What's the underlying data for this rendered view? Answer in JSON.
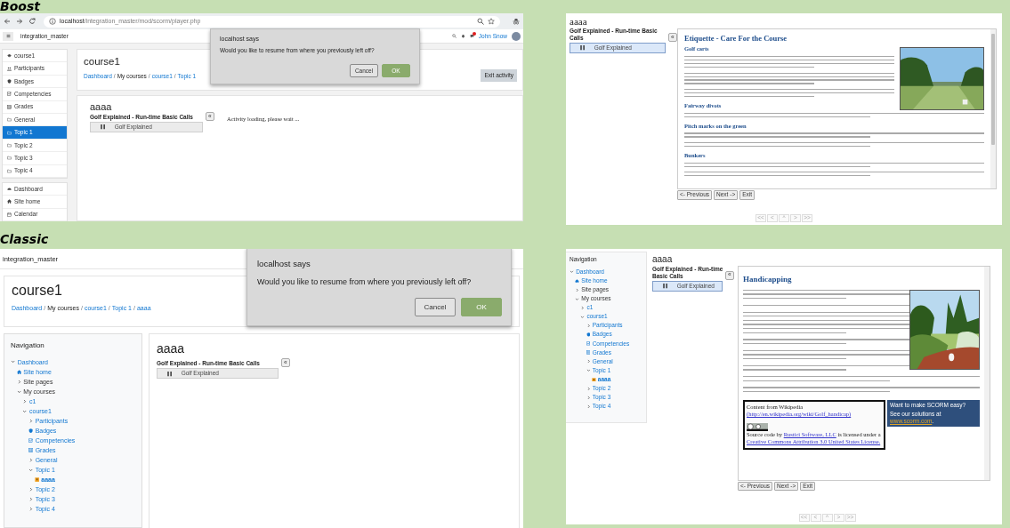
{
  "boost": {
    "caption": "Boost",
    "browser": {
      "host": "localhost",
      "path": "/integration_master/mod/scorm/player.php"
    },
    "navbar": {
      "site_name": "integration_master",
      "user_name": "John Snow",
      "message_alert": true
    },
    "sidebar": {
      "course_items": [
        {
          "label": "course1",
          "kind": "course",
          "selected": false
        },
        {
          "label": "Participants",
          "kind": "participants",
          "selected": false
        },
        {
          "label": "Badges",
          "kind": "badges",
          "selected": false
        },
        {
          "label": "Competencies",
          "kind": "competencies",
          "selected": false
        },
        {
          "label": "Grades",
          "kind": "grades",
          "selected": false
        },
        {
          "label": "General",
          "kind": "section",
          "selected": false
        },
        {
          "label": "Topic 1",
          "kind": "section",
          "selected": true
        },
        {
          "label": "Topic 2",
          "kind": "section",
          "selected": false
        },
        {
          "label": "Topic 3",
          "kind": "section",
          "selected": false
        },
        {
          "label": "Topic 4",
          "kind": "section",
          "selected": false
        }
      ],
      "site_items": [
        {
          "label": "Dashboard",
          "kind": "dashboard",
          "selected": false
        },
        {
          "label": "Site home",
          "kind": "home",
          "selected": false
        },
        {
          "label": "Calendar",
          "kind": "calendar",
          "selected": false
        }
      ]
    },
    "page_header": {
      "title": "course1",
      "breadcrumbs": [
        {
          "text": "Dashboard",
          "link": true,
          "separator": "/"
        },
        {
          "text": "My courses",
          "link": false,
          "separator": "/"
        },
        {
          "text": "course1",
          "link": true,
          "separator": "/"
        },
        {
          "text": "Topic 1",
          "link": true
        }
      ],
      "action": "Exit activity"
    },
    "activity": {
      "title": "aaaa",
      "toc_title": "Golf Explained - Run-time Basic Calls",
      "toc_toggle": "«",
      "toc_items": [
        {
          "label": "Golf Explained",
          "selected": false
        }
      ],
      "loading_text": "Activity loading, please wait ..."
    },
    "dialog": {
      "title": "localhost says",
      "message": "Would you like to resume from where you previously left off?",
      "buttons": [
        {
          "label": "Cancel",
          "primary": false
        },
        {
          "label": "OK",
          "primary": true
        }
      ]
    }
  },
  "boost_player": {
    "activity": {
      "title": "aaaa",
      "toc_title": "Golf Explained - Run-time Basic Calls",
      "toc_toggle": "«",
      "toc_items": [
        {
          "label": "Golf Explained",
          "selected": true
        }
      ]
    },
    "content": {
      "title": "Etiquette - Care For the Course",
      "sections": [
        {
          "heading": "Golf carts"
        },
        {
          "heading": "Fairway divots"
        },
        {
          "heading": "Pitch marks on the green"
        },
        {
          "heading": "Bunkers"
        }
      ]
    },
    "nav_buttons": [
      "<- Previous",
      "Next ->",
      "Exit"
    ],
    "pager": [
      "<<",
      "<",
      "^",
      ">",
      ">>"
    ]
  },
  "classic": {
    "caption": "Classic",
    "site_name": "integration_master",
    "page_header": {
      "title": "course1",
      "breadcrumbs": [
        {
          "text": "Dashboard",
          "link": true,
          "separator": "/"
        },
        {
          "text": "My courses",
          "link": false,
          "separator": "/"
        },
        {
          "text": "course1",
          "link": true,
          "separator": "/"
        },
        {
          "text": "Topic 1",
          "link": true,
          "separator": "/"
        },
        {
          "text": "aaaa",
          "link": true
        }
      ]
    },
    "navigation": {
      "title": "Navigation",
      "tree": [
        {
          "label": "Dashboard",
          "kind": "branch",
          "expanded": true,
          "link": true,
          "selected": false,
          "children": [
            {
              "label": "Site home",
              "kind": "home",
              "link": true,
              "selected": false
            },
            {
              "label": "Site pages",
              "kind": "branch",
              "expanded": false,
              "link": false,
              "selected": false
            },
            {
              "label": "My courses",
              "kind": "branch",
              "expanded": true,
              "link": false,
              "selected": false,
              "children": [
                {
                  "label": "c1",
                  "kind": "branch",
                  "expanded": false,
                  "link": true,
                  "selected": false
                },
                {
                  "label": "course1",
                  "kind": "branch",
                  "expanded": true,
                  "link": true,
                  "selected": false,
                  "children": [
                    {
                      "label": "Participants",
                      "kind": "branch",
                      "expanded": false,
                      "link": true,
                      "selected": false
                    },
                    {
                      "label": "Badges",
                      "kind": "badges",
                      "link": true,
                      "selected": false
                    },
                    {
                      "label": "Competencies",
                      "kind": "competencies",
                      "link": true,
                      "selected": false
                    },
                    {
                      "label": "Grades",
                      "kind": "grades",
                      "link": true,
                      "selected": false
                    },
                    {
                      "label": "General",
                      "kind": "branch",
                      "expanded": false,
                      "link": true,
                      "selected": false
                    },
                    {
                      "label": "Topic 1",
                      "kind": "branch",
                      "expanded": true,
                      "link": true,
                      "selected": false,
                      "children": [
                        {
                          "label": "aaaa",
                          "kind": "activity",
                          "link": true,
                          "selected": true
                        }
                      ]
                    },
                    {
                      "label": "Topic 2",
                      "kind": "branch",
                      "expanded": false,
                      "link": true,
                      "selected": false
                    },
                    {
                      "label": "Topic 3",
                      "kind": "branch",
                      "expanded": false,
                      "link": true,
                      "selected": false
                    },
                    {
                      "label": "Topic 4",
                      "kind": "branch",
                      "expanded": false,
                      "link": true,
                      "selected": false
                    }
                  ]
                }
              ]
            }
          ]
        }
      ]
    },
    "activity": {
      "title": "aaaa",
      "toc_title": "Golf Explained - Run-time Basic Calls",
      "toc_toggle": "«",
      "toc_items": [
        {
          "label": "Golf Explained",
          "selected": false
        }
      ]
    },
    "dialog": {
      "title": "localhost says",
      "message": "Would you like to resume from where you previously left off?",
      "buttons": [
        {
          "label": "Cancel",
          "primary": false
        },
        {
          "label": "OK",
          "primary": true
        }
      ]
    }
  },
  "classic_player": {
    "navigation": {
      "title": "Navigation",
      "tree": [
        {
          "label": "Dashboard",
          "kind": "branch",
          "expanded": true,
          "link": true,
          "selected": false,
          "children": [
            {
              "label": "Site home",
              "kind": "home",
              "link": true,
              "selected": false
            },
            {
              "label": "Site pages",
              "kind": "branch",
              "expanded": false,
              "link": false,
              "selected": false
            },
            {
              "label": "My courses",
              "kind": "branch",
              "expanded": true,
              "link": false,
              "selected": false,
              "children": [
                {
                  "label": "c1",
                  "kind": "branch",
                  "expanded": false,
                  "link": true,
                  "selected": false
                },
                {
                  "label": "course1",
                  "kind": "branch",
                  "expanded": true,
                  "link": true,
                  "selected": false,
                  "children": [
                    {
                      "label": "Participants",
                      "kind": "branch",
                      "expanded": false,
                      "link": true,
                      "selected": false
                    },
                    {
                      "label": "Badges",
                      "kind": "badges",
                      "link": true,
                      "selected": false
                    },
                    {
                      "label": "Competencies",
                      "kind": "competencies",
                      "link": true,
                      "selected": false
                    },
                    {
                      "label": "Grades",
                      "kind": "grades",
                      "link": true,
                      "selected": false
                    },
                    {
                      "label": "General",
                      "kind": "branch",
                      "expanded": false,
                      "link": true,
                      "selected": false
                    },
                    {
                      "label": "Topic 1",
                      "kind": "branch",
                      "expanded": true,
                      "link": true,
                      "selected": false,
                      "children": [
                        {
                          "label": "aaaa",
                          "kind": "activity",
                          "link": true,
                          "selected": true
                        }
                      ]
                    },
                    {
                      "label": "Topic 2",
                      "kind": "branch",
                      "expanded": false,
                      "link": true,
                      "selected": false
                    },
                    {
                      "label": "Topic 3",
                      "kind": "branch",
                      "expanded": false,
                      "link": true,
                      "selected": false
                    },
                    {
                      "label": "Topic 4",
                      "kind": "branch",
                      "expanded": false,
                      "link": true,
                      "selected": false
                    }
                  ]
                }
              ]
            }
          ]
        }
      ]
    },
    "activity": {
      "title": "aaaa",
      "toc_title": "Golf Explained - Run-time Basic Calls",
      "toc_toggle": "«",
      "toc_items": [
        {
          "label": "Golf Explained",
          "selected": true
        }
      ]
    },
    "content": {
      "title": "Handicapping",
      "credit": {
        "source_text": "Content from Wikipedia",
        "source_link": "(http://en.wikipedia.org/wiki/Golf_handicap)",
        "license_prefix": "Source code by",
        "author_link": "Rustici Software, LLC",
        "license_middle": "is licensed under a",
        "license_link": "Creative Commons Attribution 3.0 United States License."
      },
      "promo": {
        "headline": "Want to make SCORM easy?",
        "text": "See our solutions at",
        "link": "www.scorm.com",
        "suffix": "."
      }
    },
    "nav_buttons": [
      "<- Previous",
      "Next ->",
      "Exit"
    ],
    "pager": [
      "<<",
      "<",
      "^",
      ">",
      ">>"
    ]
  }
}
